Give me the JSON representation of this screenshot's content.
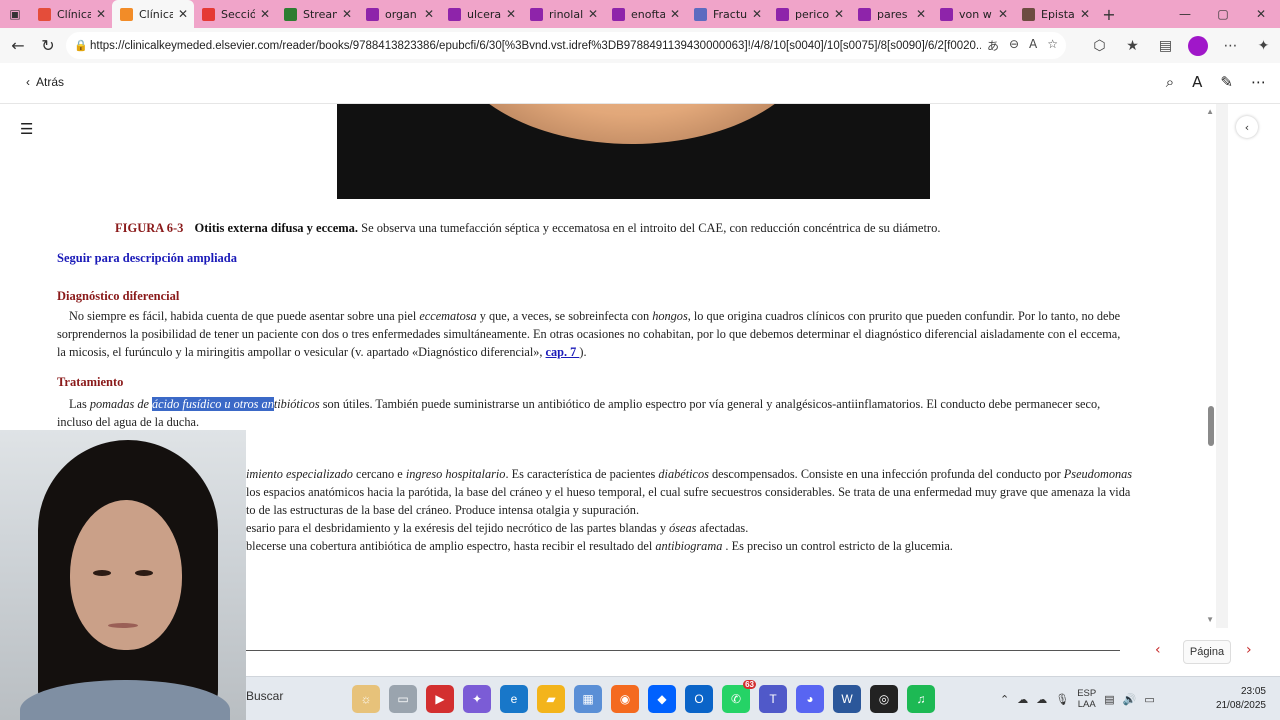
{
  "browser": {
    "tabs": [
      {
        "label": "Clínica",
        "color": "#e44d3a",
        "active": false
      },
      {
        "label": "Clínica",
        "color": "#f28c28",
        "active": true
      },
      {
        "label": "Sección",
        "color": "#e53935",
        "active": false
      },
      {
        "label": "Stream",
        "color": "#2e7d32",
        "active": false
      },
      {
        "label": "organ",
        "color": "#8e24aa",
        "active": false
      },
      {
        "label": "ulcera",
        "color": "#8e24aa",
        "active": false
      },
      {
        "label": "rinolal",
        "color": "#8e24aa",
        "active": false
      },
      {
        "label": "enofta",
        "color": "#8e24aa",
        "active": false
      },
      {
        "label": "Fractu",
        "color": "#5c6bc0",
        "active": false
      },
      {
        "label": "perico",
        "color": "#8e24aa",
        "active": false
      },
      {
        "label": "pares",
        "color": "#8e24aa",
        "active": false
      },
      {
        "label": "von w",
        "color": "#8e24aa",
        "active": false
      },
      {
        "label": "Epista",
        "color": "#6d4c41",
        "active": false
      }
    ],
    "url": "https://clinicalkeymeded.elsevier.com/reader/books/9788413823386/epubcfi/6/30[%3Bvnd.vst.idref%3DB9788491139430000063]!/4/8/10[s0040]/10[s0075]/8[s0090]/6/2[f0020..."
  },
  "reader": {
    "back_label": "Atrás",
    "figure_label": "FIGURA 6-3",
    "figure_title": "Otitis externa difusa y eccema.",
    "figure_caption": "Se observa una tumefacción séptica y eccematosa en el introito del CAE, con reducción concéntrica de su diámetro.",
    "expand_link": "Seguir para descripción ampliada",
    "section_diagnosis": "Diagnóstico diferencial",
    "section_treatment": "Tratamiento",
    "diag_p1_a": "No siempre es fácil, habida cuenta de que puede asentar sobre una piel ",
    "diag_p1_b": "eccematosa",
    "diag_p1_c": " y que, a veces, se sobreinfecta con ",
    "diag_p1_d": "hongos",
    "diag_p1_e": ", lo que origina cuadros clínicos con prurito que pueden confundir. Por lo tanto, no debe",
    "diag_p2": "sorprendernos la posibilidad de tener un paciente con dos o tres enfermedades simultáneamente. En otras ocasiones no cohabitan, por lo que debemos determinar el diagnóstico diferencial aisladamente con el eccema,",
    "diag_p3_a": "la micosis, el furúnculo y la miringitis ampollar o vesicular (v. apartado «Diagnóstico diferencial», ",
    "diag_p3_link": "cap. 7 ",
    "diag_p3_b": ").",
    "treat_a": "Las ",
    "treat_b": "pomadas de ",
    "treat_hl": "ácido fusídico u otros an",
    "treat_c": "tibióticos",
    "treat_d": " son útiles. También puede suministrarse un antibiótico de amplio espectro por vía general y analgésicos-antiinflamatorios. El conducto debe permanecer seco,",
    "treat_e": "incluso del agua de la ducha.",
    "m1_a": "imiento especializado",
    "m1_b": " cercano e ",
    "m1_c": "ingreso hospitalario",
    "m1_d": ". Es característica de pacientes ",
    "m1_e": "diabéticos",
    "m1_f": " descompensados. Consiste en una infección profunda del conducto por ",
    "m1_g": "Pseudomonas",
    "m2": " los espacios anatómicos hacia la parótida, la base del cráneo y el hueso temporal, el cual sufre secuestros considerables. Se trata de una enfermedad muy grave que amenaza la vida",
    "m3": "to de las estructuras de la base del cráneo. Produce intensa otalgia y supuración.",
    "m4_a": "esario para el desbridamiento y la exéresis del tejido necrótico de las partes blandas y ",
    "m4_b": "óseas",
    "m4_c": " afectadas.",
    "m5_a": "blecerse una cobertura antibiótica de amplio espectro, hasta recibir el resultado del ",
    "m5_b": "antibiograma",
    "m5_c": " . Es preciso un control estricto de la glucemia.",
    "page_button": "Página"
  },
  "taskbar": {
    "search_label": "Buscar",
    "lang_top": "ESP",
    "lang_bottom": "LAA",
    "time": "23:05",
    "date": "21/08/2025",
    "whatsapp_badge": "63"
  }
}
